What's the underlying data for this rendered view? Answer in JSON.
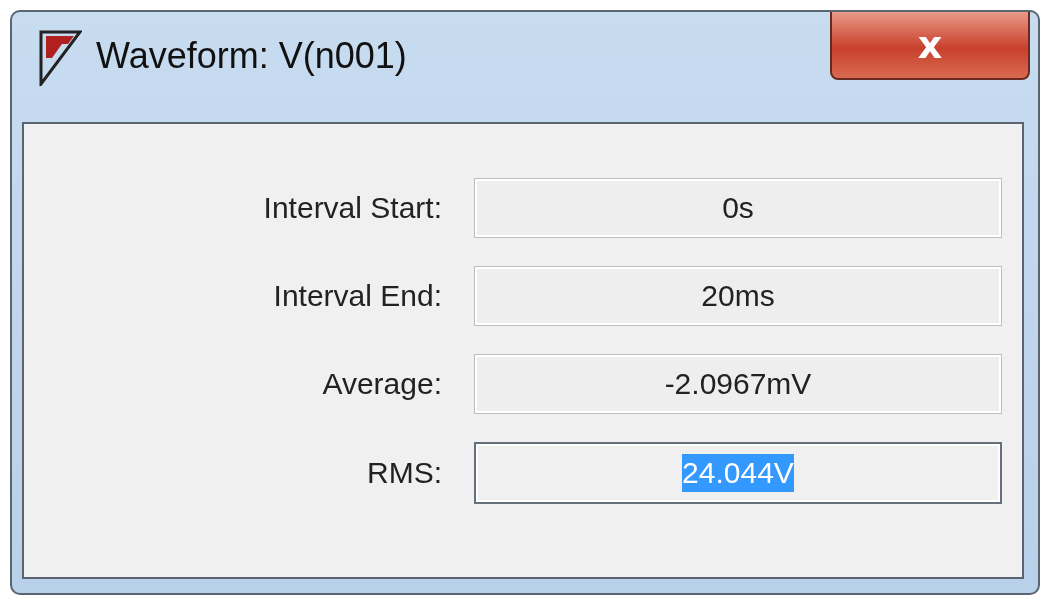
{
  "window": {
    "title": "Waveform: V(n001)",
    "close": "x"
  },
  "rows": [
    {
      "label": "Interval Start:",
      "value": "0s",
      "selected": false
    },
    {
      "label": "Interval End:",
      "value": "20ms",
      "selected": false
    },
    {
      "label": "Average:",
      "value": "-2.0967mV",
      "selected": false
    },
    {
      "label": "RMS:",
      "value": "24.044V",
      "selected": true
    }
  ]
}
